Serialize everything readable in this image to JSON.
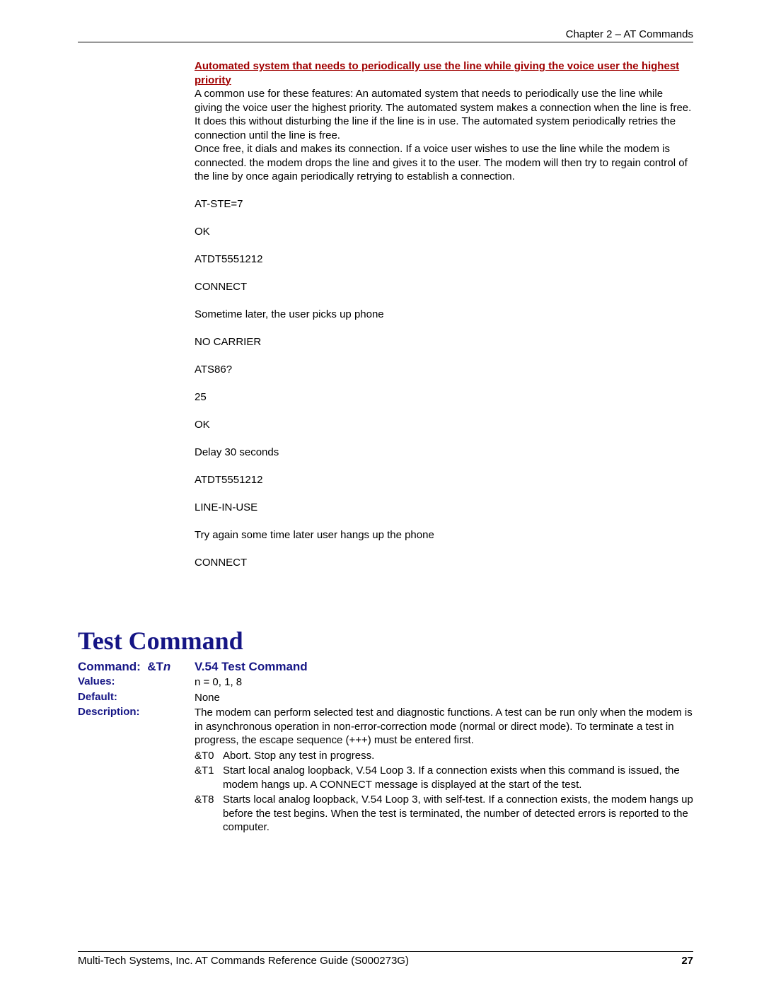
{
  "header": {
    "chapter": "Chapter 2 – AT Commands"
  },
  "scenario": {
    "title": "Automated system that needs to periodically use the line while giving the voice user the highest priority",
    "para1": "A common use for these features: An automated system that needs to periodically use the line while giving the voice user the highest priority. The automated system makes a connection when the line is free. It does this without disturbing the line if the line is in use. The automated system periodically retries the connection until the line is free.",
    "para2": "Once free, it dials and makes its connection. If a voice user wishes to use the line while the modem is connected. the modem drops the line and gives it to the user. The modem will then try to regain control of the line by once again periodically retrying to establish a connection.",
    "lines": {
      "l1": "AT-STE=7",
      "l2": "OK",
      "l3": "ATDT5551212",
      "l4": "CONNECT",
      "l5": "Sometime later, the user picks up phone",
      "l6": "NO CARRIER",
      "l7": "ATS86?",
      "l8": "25",
      "l9": "OK",
      "l10": "Delay 30 seconds",
      "l11": "ATDT5551212",
      "l12": "LINE-IN-USE",
      "l13": "Try again some time later user hangs up the phone",
      "l14": "CONNECT"
    }
  },
  "section": {
    "title": "Test Command"
  },
  "command": {
    "label": "Command:",
    "code_prefix": "&T",
    "code_suffix": "n",
    "name": "V.54 Test Command",
    "values_label": "Values:",
    "values": "n = 0, 1, 8",
    "default_label": "Default:",
    "default": "None",
    "desc_label": "Description:",
    "desc": "The modem can perform selected test and diagnostic functions. A test can be run only when the modem is in asynchronous operation in non-error-correction mode (normal or direct mode). To terminate a test in progress, the escape sequence (+++) must be entered first.",
    "opts": [
      {
        "code": "&T0",
        "text": "Abort. Stop any test in progress."
      },
      {
        "code": "&T1",
        "text": "Start local analog loopback, V.54 Loop 3. If a connection exists when this command is issued, the modem hangs up. A CONNECT message is displayed at the start of the test."
      },
      {
        "code": "&T8",
        "text": "Starts local analog loopback, V.54 Loop 3, with self-test. If a connection exists, the modem hangs up before the test begins. When the test is terminated, the number of detected errors is reported to the computer."
      }
    ]
  },
  "footer": {
    "text": "Multi-Tech Systems, Inc. AT Commands Reference Guide (S000273G)",
    "page": "27"
  }
}
